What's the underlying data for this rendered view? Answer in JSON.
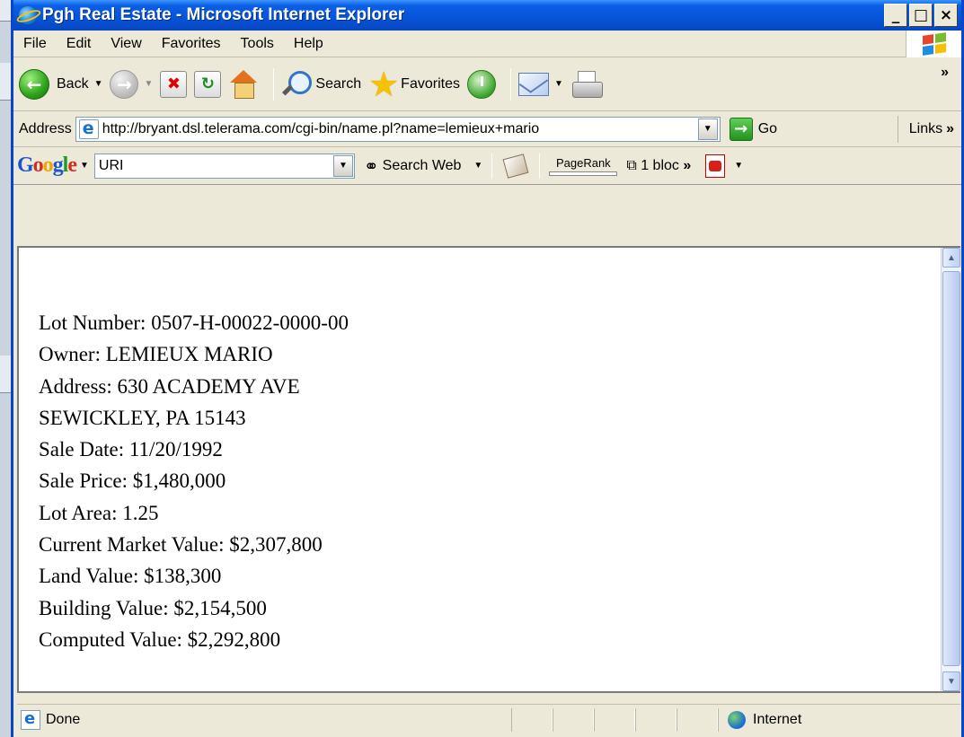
{
  "window": {
    "title": "Pgh Real Estate - Microsoft Internet Explorer",
    "controls": {
      "minimize": "_",
      "maximize": "□",
      "close": "×"
    }
  },
  "menu": [
    "File",
    "Edit",
    "View",
    "Favorites",
    "Tools",
    "Help"
  ],
  "toolbar": {
    "back_label": "Back",
    "search_label": "Search",
    "favorites_label": "Favorites",
    "overflow": "»"
  },
  "address": {
    "label": "Address",
    "url": "http://bryant.dsl.telerama.com/cgi-bin/name.pl?name=lemieux+mario",
    "go_label": "Go",
    "links_label": "Links"
  },
  "google": {
    "logo": {
      "G": "G",
      "o1": "o",
      "o2": "o",
      "g": "g",
      "l": "l",
      "e": "e"
    },
    "query": "URI",
    "search_web_label": "Search Web",
    "pagerank_label": "PageRank",
    "popup_label": "1 bloc",
    "overflow": "»"
  },
  "property": {
    "lines": [
      "Lot Number: 0507-H-00022-0000-00",
      "Owner: LEMIEUX MARIO",
      "Address: 630 ACADEMY AVE",
      "SEWICKLEY, PA 15143",
      "Sale Date: 11/20/1992",
      "Sale Price: $1,480,000",
      "Lot Area: 1.25",
      "Current Market Value: $2,307,800",
      "Land Value: $138,300",
      "Building Value: $2,154,500",
      "Computed Value: $2,292,800"
    ]
  },
  "status": {
    "text": "Done",
    "zone": "Internet"
  }
}
